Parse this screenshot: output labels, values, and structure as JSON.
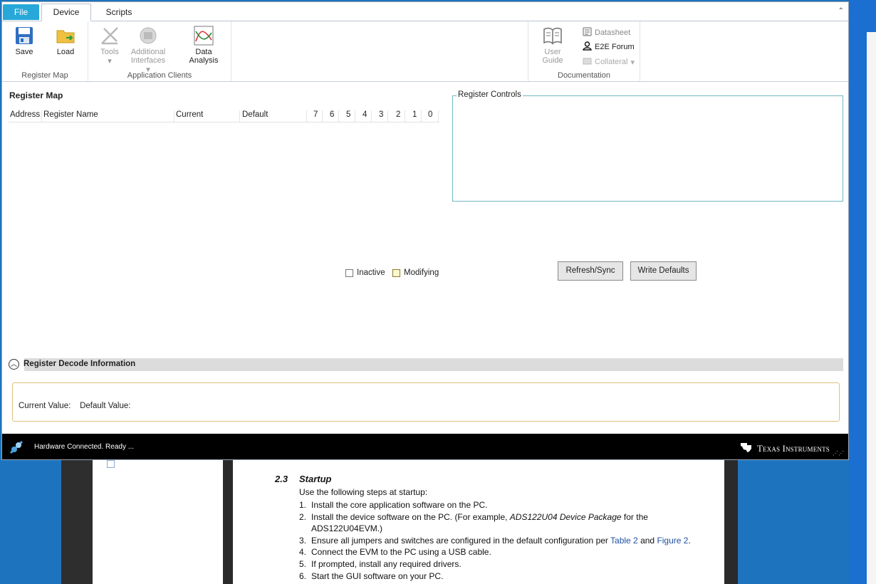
{
  "tabs": {
    "file": "File",
    "device": "Device",
    "scripts": "Scripts"
  },
  "ribbon": {
    "register_map_group": {
      "label": "Register Map",
      "save": "Save",
      "load": "Load"
    },
    "app_clients_group": {
      "label": "Application Clients",
      "tools": "Tools",
      "additional_line1": "Additional",
      "additional_line2": "Interfaces",
      "data_line1": "Data",
      "data_line2": "Analysis"
    },
    "documentation_group": {
      "label": "Documentation",
      "user_line1": "User",
      "user_line2": "Guide",
      "datasheet": "Datasheet",
      "e2e": "E2E Forum",
      "collateral": "Collateral"
    }
  },
  "register_map": {
    "title": "Register Map",
    "columns": [
      "Address",
      "Register Name",
      "Current",
      "Default",
      "7",
      "6",
      "5",
      "4",
      "3",
      "2",
      "1",
      "0"
    ],
    "legend_inactive": "Inactive",
    "legend_modifying": "Modifying"
  },
  "register_controls": {
    "title": "Register Controls",
    "refresh": "Refresh/Sync",
    "write_defaults": "Write Defaults"
  },
  "decode": {
    "title": "Register Decode Information",
    "current_label": "Current Value:",
    "default_label": "Default Value:"
  },
  "status": {
    "text": "Hardware Connected.  Ready ...",
    "brand": "Texas Instruments"
  },
  "pdf": {
    "section_number": "2.3",
    "section_title": "Startup",
    "intro": "Use the following steps at startup:",
    "steps": [
      {
        "n": "1.",
        "text": "Install the core application software on the PC."
      },
      {
        "n": "2.",
        "text_a": "Install the device software on the PC. (For example, ",
        "text_em": "ADS122U04 Device Package",
        "text_b": " for the ADS122U04EVM.)"
      },
      {
        "n": "3.",
        "text_a": "Ensure all jumpers and switches are configured in the default configuration per ",
        "link1": "Table 2",
        "mid": " and ",
        "link2": "Figure 2",
        "end": "."
      },
      {
        "n": "4.",
        "text": "Connect the EVM to the PC using a USB cable."
      },
      {
        "n": "5.",
        "text": "If prompted, install any required drivers."
      },
      {
        "n": "6.",
        "text": "Start the GUI software on your PC."
      }
    ]
  }
}
